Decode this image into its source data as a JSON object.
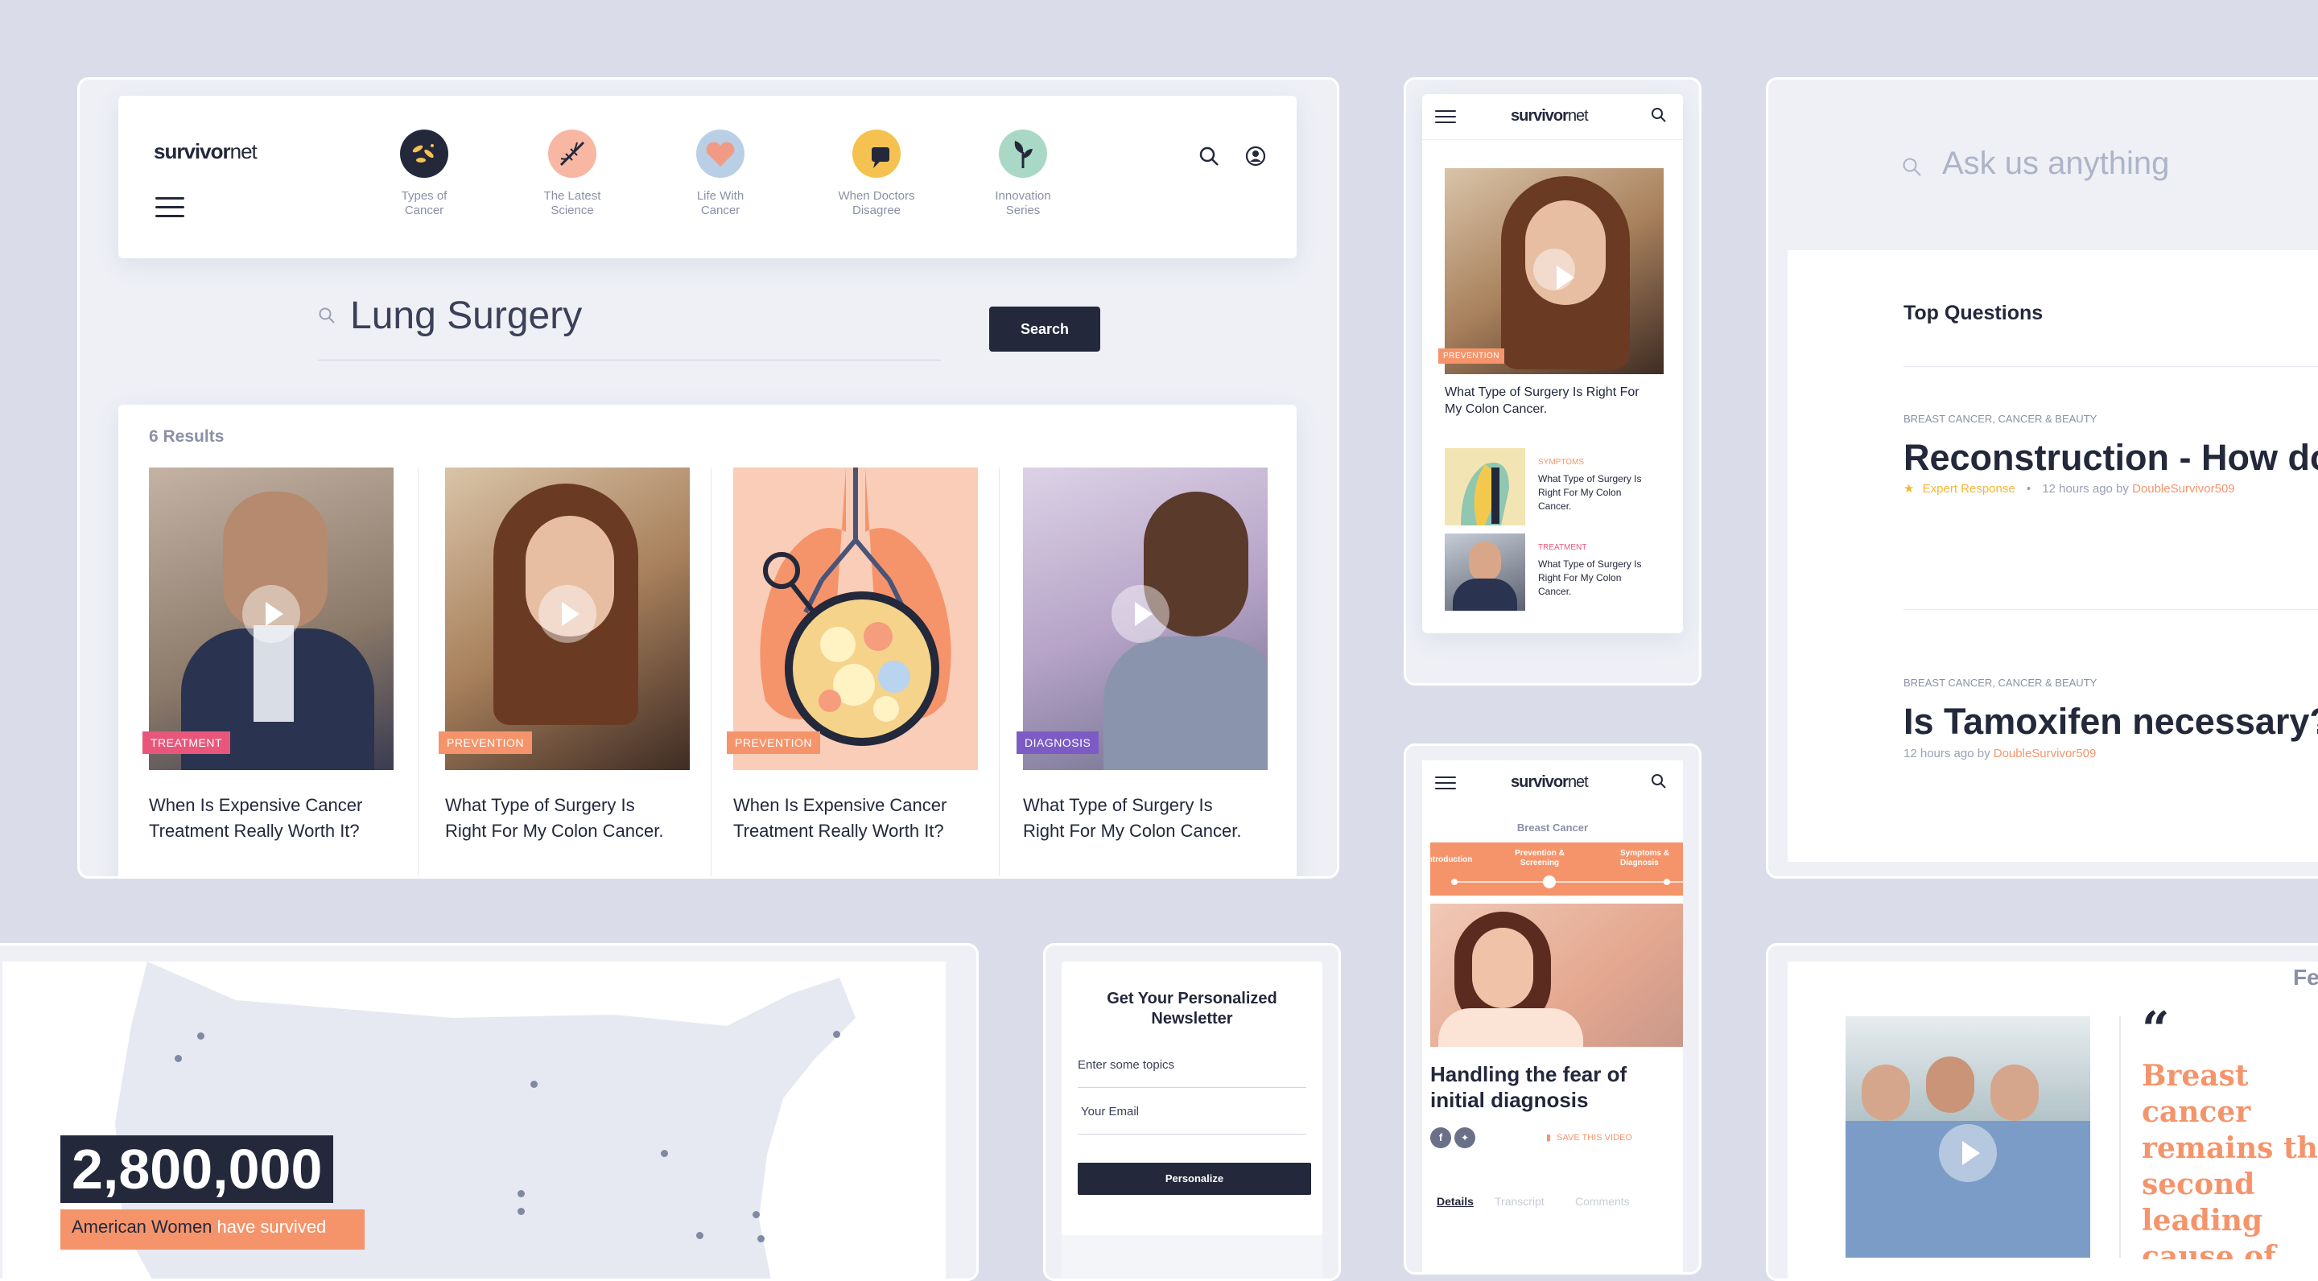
{
  "brand": {
    "name_bold": "survivor",
    "name_light": "net"
  },
  "desktop": {
    "nav": [
      {
        "label": "Types of Cancer",
        "icon": "bacteria-icon",
        "color": "#23283b"
      },
      {
        "label": "The Latest Science",
        "icon": "dna-icon",
        "color": "#f7b7a3"
      },
      {
        "label": "Life With Cancer",
        "icon": "heart-icon",
        "color": "#b9cfe6"
      },
      {
        "label": "When Doctors Disagree",
        "icon": "speech-bubble-icon",
        "color": "#f5c251"
      },
      {
        "label": "Innovation Series",
        "icon": "plant-icon",
        "color": "#a9d9c6"
      }
    ],
    "search": {
      "query": "Lung Surgery",
      "button": "Search"
    },
    "results_count": "6 Results",
    "results": [
      {
        "tag": "TREATMENT",
        "tag_color": "#e8577b",
        "title": "When Is Expensive Cancer Treatment Really Worth It?"
      },
      {
        "tag": "PREVENTION",
        "tag_color": "#f5946b",
        "title": "What Type of Surgery Is Right For My Colon Cancer."
      },
      {
        "tag": "PREVENTION",
        "tag_color": "#f5946b",
        "title": "When Is Expensive Cancer Treatment Really Worth It?"
      },
      {
        "tag": "DIAGNOSIS",
        "tag_color": "#7c5cc4",
        "title": "What Type of Surgery Is Right For My Colon Cancer."
      }
    ]
  },
  "mobile1": {
    "hero_tag": "PREVENTION",
    "hero_title": "What Type of Surgery Is Right For My Colon Cancer.",
    "items": [
      {
        "tag": "SYMPTOMS",
        "title": "What Type of Surgery Is Right For My Colon Cancer."
      },
      {
        "tag": "TREATMENT",
        "title": "What Type of Surgery Is Right For My Colon Cancer."
      }
    ]
  },
  "mobile2": {
    "section": "Breast Cancer",
    "steps": [
      "Introduction",
      "Prevention & Screening",
      "Symptoms & Diagnosis"
    ],
    "title": "Handling the fear of initial diagnosis",
    "save": "SAVE THIS VIDEO",
    "tabs": [
      "Details",
      "Transcript",
      "Comments"
    ]
  },
  "qa": {
    "search_placeholder": "Ask us anything",
    "heading": "Top Questions",
    "questions": [
      {
        "category": "BREAST CANCER, CANCER & BEAUTY",
        "title": "Reconstruction - How do I know what size to go?!?",
        "expert": "Expert Response",
        "time": "12 hours ago by",
        "author": "DoubleSurvivor509"
      },
      {
        "category": "BREAST CANCER, CANCER & BEAUTY",
        "title": "Is Tamoxifen necessary?",
        "time": "12 hours ago by",
        "author": "DoubleSurvivor509"
      }
    ]
  },
  "map": {
    "stat": "2,800,000",
    "caption_strong": "American Women",
    "caption_rest": " have survived"
  },
  "newsletter": {
    "title": "Get Your Personalized Newsletter",
    "topics_placeholder": "Enter some topics",
    "email_placeholder": "Your Email",
    "button": "Personalize"
  },
  "feature": {
    "heading_partial": "Fe",
    "quote": "Breast cancer remains the second leading cause of cancer related mortality"
  }
}
